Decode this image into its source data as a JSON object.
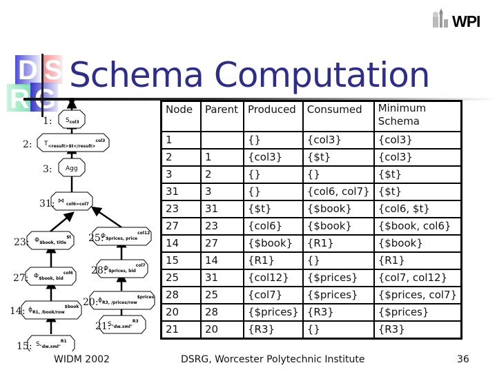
{
  "slide": {
    "title": "Schema Computation",
    "logo_letters": [
      "D",
      "S",
      "R",
      "G"
    ],
    "institution_logo": "WPI",
    "footer_left": "WIDM 2002",
    "footer_center": "DSRG, Worcester Polytechnic Institute",
    "page_number": "36"
  },
  "tree": {
    "root_icon": "output-dot-icon",
    "nodes": [
      {
        "id": "1",
        "label": "1:",
        "op": "S",
        "sub": "col3",
        "sup": ""
      },
      {
        "id": "2",
        "label": "2:",
        "op": "T",
        "sub": "<result>$t</result>",
        "sup": "col3"
      },
      {
        "id": "3",
        "label": "3:",
        "op": "Agg",
        "sub": "",
        "sup": ""
      },
      {
        "id": "31",
        "label": "31:",
        "op": "⋈",
        "sub": "col6=col7",
        "sup": ""
      },
      {
        "id": "23",
        "label": "23:",
        "op": "Φ",
        "sub": "$book, title",
        "sup": "$t"
      },
      {
        "id": "25",
        "label": "25:",
        "op": "Φ",
        "sub": "$prices, price",
        "sup": "col12"
      },
      {
        "id": "27",
        "label": "27:",
        "op": "Φ",
        "sub": "$book, bid",
        "sup": "col6"
      },
      {
        "id": "28",
        "label": "28:",
        "op": "Φ",
        "sub": "$prices, bid",
        "sup": "col7"
      },
      {
        "id": "14",
        "label": "14:",
        "op": "ϕ",
        "sub": "R1, /book/row",
        "sup": "$book"
      },
      {
        "id": "20",
        "label": "20:",
        "op": "ϕ",
        "sub": "R3, /prices/row",
        "sup": "$prices"
      },
      {
        "id": "15",
        "label": "15:",
        "op": "S",
        "sub": "\"dw.xml\"",
        "sup": "R1"
      },
      {
        "id": "21",
        "label": "21:",
        "op": "S",
        "sub": "\"dw.xml\"",
        "sup": "R3"
      }
    ]
  },
  "table": {
    "headers": [
      "Node",
      "Parent",
      "Produced",
      "Consumed",
      "Minimum Schema"
    ],
    "rows": [
      [
        "1",
        "",
        "{}",
        "{col3}",
        "{col3}"
      ],
      [
        "2",
        "1",
        "{col3}",
        "{$t}",
        "{col3}"
      ],
      [
        "3",
        "2",
        "{}",
        "{}",
        "{$t}"
      ],
      [
        "31",
        "3",
        "{}",
        "{col6, col7}",
        "{$t}"
      ],
      [
        "23",
        "31",
        "{$t}",
        "{$book}",
        "{col6, $t}"
      ],
      [
        "27",
        "23",
        "{col6}",
        "{$book}",
        "{$book, col6}"
      ],
      [
        "14",
        "27",
        "{$book}",
        "{R1}",
        "{$book}"
      ],
      [
        "15",
        "14",
        "{R1}",
        "{}",
        "{R1}"
      ],
      [
        "25",
        "31",
        "{col12}",
        "{$prices}",
        "{col7, col12}"
      ],
      [
        "28",
        "25",
        "{col7}",
        "{$prices}",
        "{$prices, col7}"
      ],
      [
        "20",
        "28",
        "{$prices}",
        "{R3}",
        "{$prices}"
      ],
      [
        "21",
        "20",
        "{R3}",
        "{}",
        "{R3}"
      ]
    ]
  }
}
